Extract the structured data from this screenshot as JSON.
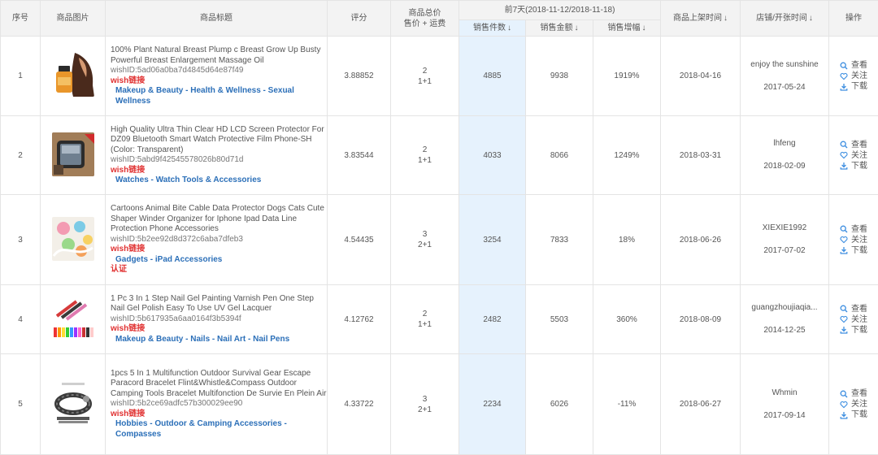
{
  "headers": {
    "index": "序号",
    "image": "商品图片",
    "title": "商品标题",
    "rating": "评分",
    "price_line1": "商品总价",
    "price_line2": "售价 + 运费",
    "period": "前7天(2018-11-12/2018-11-18)",
    "sales_qty": "销售件数",
    "sales_amount": "销售金额",
    "sales_growth": "销售增幅",
    "listed_time": "商品上架时间",
    "store": "店铺/开张时间",
    "actions": "操作"
  },
  "sort_arrow": "↓",
  "actions": {
    "view": "查看",
    "follow": "关注",
    "download": "下载"
  },
  "wish_link_label": "wish链接",
  "rows": [
    {
      "index": "1",
      "title": "100% Plant Natural Breast Plump c Breast Grow Up Busty Powerful Breast Enlargement Massage Oil",
      "wish_id": "wishID:5ad06a0ba7d4845d64e87f49",
      "categories": [
        "Makeup & Beauty",
        "Health & Wellness",
        "Sexual Wellness"
      ],
      "verified": "",
      "rating": "3.88852",
      "price": "2",
      "shipping": "1+1",
      "sales_qty": "4885",
      "sales_amount": "9938",
      "sales_growth": "1919%",
      "listed_time": "2018-04-16",
      "store_name": "enjoy the sunshine",
      "store_date": "2017-05-24",
      "thumb_icon": "oil-bottle-thumbnail"
    },
    {
      "index": "2",
      "title": "High Quality Ultra Thin Clear HD LCD Screen Protector For DZ09 Bluetooth Smart Watch Protective Film Phone-SH (Color: Transparent)",
      "wish_id": "wishID:5abd9f42545578026b80d71d",
      "categories": [
        "Watches",
        "Watch Tools & Accessories"
      ],
      "verified": "",
      "rating": "3.83544",
      "price": "2",
      "shipping": "1+1",
      "sales_qty": "4033",
      "sales_amount": "8066",
      "sales_growth": "1249%",
      "listed_time": "2018-03-31",
      "store_name": "lhfeng",
      "store_date": "2018-02-09",
      "thumb_icon": "smartwatch-thumbnail"
    },
    {
      "index": "3",
      "title": "Cartoons Animal Bite Cable Data Protector Dogs Cats Cute Shaper Winder Organizer for Iphone Ipad Data Line Protection Phone Accessories",
      "wish_id": "wishID:5b2ee92d8d372c6aba7dfeb3",
      "categories": [
        "Gadgets",
        "iPad Accessories"
      ],
      "verified": "认证",
      "rating": "4.54435",
      "price": "3",
      "shipping": "2+1",
      "sales_qty": "3254",
      "sales_amount": "7833",
      "sales_growth": "18%",
      "listed_time": "2018-06-26",
      "store_name": "XIEXIE1992",
      "store_date": "2017-07-02",
      "thumb_icon": "cable-protector-thumbnail"
    },
    {
      "index": "4",
      "title": "1 Pc 3 In 1 Step Nail Gel Painting Varnish Pen One Step Nail Gel Polish Easy To Use UV Gel Lacquer",
      "wish_id": "wishID:5b617935a6aa0164f3b5394f",
      "categories": [
        "Makeup & Beauty",
        "Nails",
        "Nail Art",
        "Nail Pens"
      ],
      "verified": "",
      "rating": "4.12762",
      "price": "2",
      "shipping": "1+1",
      "sales_qty": "2482",
      "sales_amount": "5503",
      "sales_growth": "360%",
      "listed_time": "2018-08-09",
      "store_name": "guangzhoujiaqia...",
      "store_date": "2014-12-25",
      "thumb_icon": "nail-pen-thumbnail"
    },
    {
      "index": "5",
      "title": "1pcs 5 In 1 Multifunction Outdoor Survival Gear Escape Paracord Bracelet Flint&Whistle&Compass Outdoor Camping Tools Bracelet Multifonction De Survie En Plein Air",
      "wish_id": "wishID:5b2ce69adfc57b300029ee90",
      "categories": [
        "Hobbies",
        "Outdoor & Camping Accessories",
        "Compasses"
      ],
      "verified": "",
      "rating": "4.33722",
      "price": "3",
      "shipping": "2+1",
      "sales_qty": "2234",
      "sales_amount": "6026",
      "sales_growth": "-11%",
      "listed_time": "2018-06-27",
      "store_name": "Whmin",
      "store_date": "2017-09-14",
      "thumb_icon": "paracord-bracelet-thumbnail"
    }
  ],
  "colors": {
    "header_bg": "#f3f3f3",
    "active_column": "#e6f2fd",
    "link_red": "#e03030",
    "category_blue": "#2b6fb8",
    "icon_blue": "#3d8ee0"
  }
}
